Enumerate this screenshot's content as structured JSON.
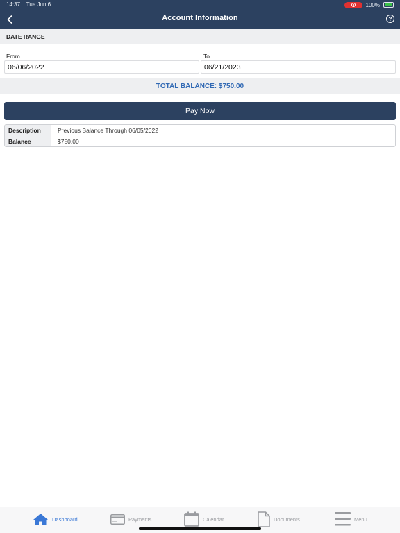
{
  "status_bar": {
    "time": "14:37",
    "date": "Tue Jun 6",
    "battery": "100%"
  },
  "header": {
    "title": "Account Information",
    "help_symbol": "?"
  },
  "date_range": {
    "section_title": "DATE RANGE",
    "from_label": "From",
    "from_value": "06/06/2022",
    "to_label": "To",
    "to_value": "06/21/2023"
  },
  "total_balance": "TOTAL BALANCE: $750.00",
  "pay_button": "Pay Now",
  "details": [
    {
      "key": "Description",
      "value": "Previous Balance Through 06/05/2022"
    },
    {
      "key": "Balance",
      "value": "$750.00"
    }
  ],
  "tabs": [
    {
      "label": "Dashboard",
      "icon": "home-icon",
      "active": true
    },
    {
      "label": "Payments",
      "icon": "credit-card-icon",
      "active": false
    },
    {
      "label": "Calendar",
      "icon": "calendar-icon",
      "active": false
    },
    {
      "label": "Documents",
      "icon": "document-icon",
      "active": false
    },
    {
      "label": "Menu",
      "icon": "menu-icon",
      "active": false
    }
  ],
  "colors": {
    "header": "#2c4160",
    "accent": "#3169b4",
    "tab_active": "#3a78d6",
    "tab_inactive": "#9a9ca0"
  }
}
